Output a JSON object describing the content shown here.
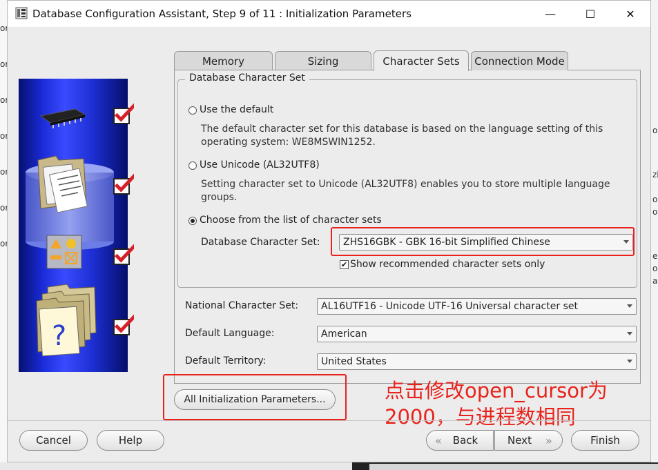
{
  "window": {
    "title": "Database Configuration Assistant, Step 9 of 11 : Initialization Parameters",
    "minimize_glyph": "—",
    "maximize_glyph": "☐",
    "close_glyph": "✕"
  },
  "tabs": [
    {
      "label": "Memory"
    },
    {
      "label": "Sizing"
    },
    {
      "label": "Character Sets",
      "active": true
    },
    {
      "label": "Connection Mode"
    }
  ],
  "charset_group": {
    "title": "Database Character Set",
    "option_default": "Use the default",
    "default_desc": "The default character set for this database is based on the language setting of this operating system: WE8MSWIN1252.",
    "option_unicode": "Use Unicode (AL32UTF8)",
    "unicode_desc": "Setting character set to Unicode (AL32UTF8) enables you to store multiple language groups.",
    "option_list": "Choose from the list of character sets",
    "db_charset_label": "Database Character Set:",
    "db_charset_value": "ZHS16GBK - GBK 16-bit Simplified Chinese",
    "show_recommended": "Show recommended character sets only",
    "selected_option": "list"
  },
  "national_charset": {
    "label": "National Character Set:",
    "value": "AL16UTF16 - Unicode UTF-16 Universal character set"
  },
  "default_language": {
    "label": "Default Language:",
    "value": "American"
  },
  "default_territory": {
    "label": "Default Territory:",
    "value": "United States"
  },
  "all_params_button": "All Initialization Parameters...",
  "footer": {
    "cancel": "Cancel",
    "help": "Help",
    "back": "Back",
    "next": "Next",
    "finish": "Finish"
  },
  "annotation": {
    "line1": "点击修改open_cursor为",
    "line2": "2000，与进程数相同"
  },
  "background_fragments": {
    "left": [
      "or",
      "or",
      "or",
      "or",
      "or",
      "or",
      "or"
    ],
    "right": [
      "o",
      "zi",
      "o",
      "o",
      "e",
      "o",
      "a"
    ]
  },
  "colors": {
    "annotation": "#e8231d",
    "side_panel": "#1a2bd8",
    "check_mark": "#d6202a"
  }
}
